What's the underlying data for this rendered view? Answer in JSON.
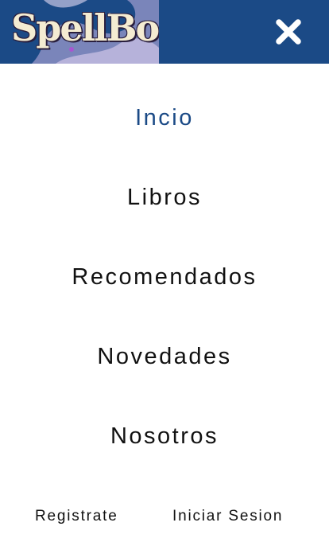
{
  "header": {
    "logo_text": "SpellBook",
    "close_icon": "close-icon",
    "background_color": "#1b4a86"
  },
  "menu": {
    "items": [
      {
        "label": "Incio",
        "active": true
      },
      {
        "label": "Libros",
        "active": false
      },
      {
        "label": "Recomendados",
        "active": false
      },
      {
        "label": "Novedades",
        "active": false
      },
      {
        "label": "Nosotros",
        "active": false
      }
    ],
    "active_color": "#1b4a86"
  },
  "auth": {
    "register_label": "Registrate",
    "login_label": "Iniciar Sesion"
  }
}
